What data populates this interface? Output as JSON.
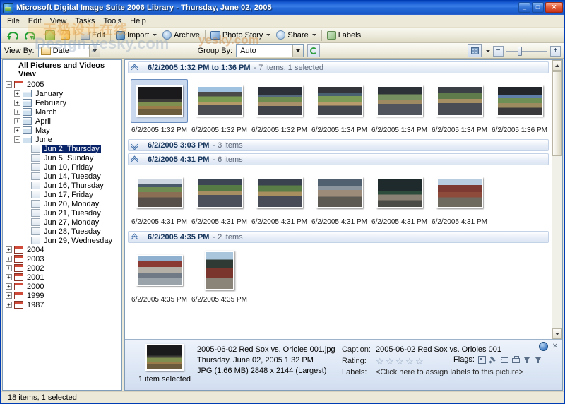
{
  "window": {
    "title": "Microsoft Digital Image Suite 2006 Library - Thursday, June 02, 2005",
    "minimize_label": "_",
    "maximize_label": "□",
    "close_label": "✕"
  },
  "menubar": {
    "items": [
      {
        "label": "File"
      },
      {
        "label": "Edit"
      },
      {
        "label": "View"
      },
      {
        "label": "Tasks"
      },
      {
        "label": "Tools"
      },
      {
        "label": "Help"
      }
    ]
  },
  "toolbar": {
    "undo_label": "",
    "redo_label": "",
    "buttons": [
      {
        "label": "Edit",
        "icon": "edit-icon",
        "has_arrow": false
      },
      {
        "label": "Import",
        "icon": "import-icon",
        "has_arrow": true
      },
      {
        "label": "Archive",
        "icon": "archive-icon",
        "has_arrow": false
      },
      {
        "label": "Photo Story",
        "icon": "photo-story-icon",
        "has_arrow": true
      },
      {
        "label": "Share",
        "icon": "share-icon",
        "has_arrow": true
      },
      {
        "label": "Labels",
        "icon": "labels-icon",
        "has_arrow": false
      }
    ]
  },
  "viewbar": {
    "view_by_label": "View By:",
    "view_by_value": "Date",
    "group_by_label": "Group By:",
    "group_by_value": "Auto",
    "refresh_icon": "refresh-icon",
    "grid_view_icon": "grid-view-icon",
    "zoom_out_label": "−",
    "zoom_in_label": "+"
  },
  "tree": {
    "root_label": "All Pictures and Videos View",
    "nodes": [
      {
        "label": "2005",
        "level": 1,
        "expander": "−",
        "type": "year"
      },
      {
        "label": "January",
        "level": 2,
        "expander": "+",
        "type": "month"
      },
      {
        "label": "February",
        "level": 2,
        "expander": "+",
        "type": "month"
      },
      {
        "label": "March",
        "level": 2,
        "expander": "+",
        "type": "month"
      },
      {
        "label": "April",
        "level": 2,
        "expander": "+",
        "type": "month"
      },
      {
        "label": "May",
        "level": 2,
        "expander": "+",
        "type": "month"
      },
      {
        "label": "June",
        "level": 2,
        "expander": "−",
        "type": "month"
      },
      {
        "label": "Jun 2, Thursday",
        "level": 3,
        "expander": "",
        "type": "day",
        "selected": true
      },
      {
        "label": "Jun 5, Sunday",
        "level": 3,
        "expander": "",
        "type": "day"
      },
      {
        "label": "Jun 10, Friday",
        "level": 3,
        "expander": "",
        "type": "day"
      },
      {
        "label": "Jun 14, Tuesday",
        "level": 3,
        "expander": "",
        "type": "day"
      },
      {
        "label": "Jun 16, Thursday",
        "level": 3,
        "expander": "",
        "type": "day"
      },
      {
        "label": "Jun 17, Friday",
        "level": 3,
        "expander": "",
        "type": "day"
      },
      {
        "label": "Jun 20, Monday",
        "level": 3,
        "expander": "",
        "type": "day"
      },
      {
        "label": "Jun 21, Tuesday",
        "level": 3,
        "expander": "",
        "type": "day"
      },
      {
        "label": "Jun 27, Monday",
        "level": 3,
        "expander": "",
        "type": "day"
      },
      {
        "label": "Jun 28, Tuesday",
        "level": 3,
        "expander": "",
        "type": "day"
      },
      {
        "label": "Jun 29, Wednesday",
        "level": 3,
        "expander": "",
        "type": "day"
      },
      {
        "label": "2004",
        "level": 1,
        "expander": "+",
        "type": "year"
      },
      {
        "label": "2003",
        "level": 1,
        "expander": "+",
        "type": "year"
      },
      {
        "label": "2002",
        "level": 1,
        "expander": "+",
        "type": "year"
      },
      {
        "label": "2001",
        "level": 1,
        "expander": "+",
        "type": "year"
      },
      {
        "label": "2000",
        "level": 1,
        "expander": "+",
        "type": "year"
      },
      {
        "label": "1999",
        "level": 1,
        "expander": "+",
        "type": "year"
      },
      {
        "label": "1987",
        "level": 1,
        "expander": "+",
        "type": "year"
      }
    ]
  },
  "groups": [
    {
      "title": "6/2/2005 1:32 PM to 1:36 PM",
      "count": "- 7 items, 1 selected",
      "state": "expanded",
      "chevron": "chevron-up-icon",
      "items": [
        {
          "caption": "6/2/2005 1:32 PM",
          "selected": true,
          "art": "ph-stadium-dark",
          "orientation": "landscape"
        },
        {
          "caption": "6/2/2005 1:32 PM",
          "selected": false,
          "art": "ph-stadium-sky",
          "orientation": "landscape"
        },
        {
          "caption": "6/2/2005 1:32 PM",
          "selected": false,
          "art": "ph-crowd-a",
          "orientation": "landscape"
        },
        {
          "caption": "6/2/2005 1:34 PM",
          "selected": false,
          "art": "ph-crowd-b",
          "orientation": "landscape"
        },
        {
          "caption": "6/2/2005 1:34 PM",
          "selected": false,
          "art": "ph-crowd-c",
          "orientation": "landscape"
        },
        {
          "caption": "6/2/2005 1:34 PM",
          "selected": false,
          "art": "ph-crowd-d",
          "orientation": "landscape"
        },
        {
          "caption": "6/2/2005 1:36 PM",
          "selected": false,
          "art": "ph-stadium-dark2",
          "orientation": "landscape"
        }
      ]
    },
    {
      "title": "6/2/2005 3:03 PM",
      "count": "- 3 items",
      "state": "collapsed",
      "chevron": "chevron-down-icon",
      "items": []
    },
    {
      "title": "6/2/2005 4:31 PM",
      "count": "- 6 items",
      "state": "expanded",
      "chevron": "chevron-up-icon",
      "items": [
        {
          "caption": "6/2/2005 4:31 PM",
          "selected": false,
          "art": "ph-fans-1",
          "orientation": "landscape"
        },
        {
          "caption": "6/2/2005 4:31 PM",
          "selected": false,
          "art": "ph-fans-2",
          "orientation": "landscape"
        },
        {
          "caption": "6/2/2005 4:31 PM",
          "selected": false,
          "art": "ph-fans-3",
          "orientation": "landscape"
        },
        {
          "caption": "6/2/2005 4:31 PM",
          "selected": false,
          "art": "ph-fans-4",
          "orientation": "landscape"
        },
        {
          "caption": "6/2/2005 4:31 PM",
          "selected": false,
          "art": "ph-greenmonster",
          "orientation": "landscape"
        },
        {
          "caption": "6/2/2005 4:31 PM",
          "selected": false,
          "art": "ph-redbrick",
          "orientation": "landscape"
        }
      ]
    },
    {
      "title": "6/2/2005 4:35 PM",
      "count": "- 2 items",
      "state": "expanded",
      "chevron": "chevron-up-icon",
      "items": [
        {
          "caption": "6/2/2005 4:35 PM",
          "selected": false,
          "art": "ph-street",
          "orientation": "landscape"
        },
        {
          "caption": "6/2/2005 4:35 PM",
          "selected": false,
          "art": "ph-tall-park",
          "orientation": "portrait"
        }
      ]
    }
  ],
  "details": {
    "selection_text": "1 item selected",
    "filename": "2005-06-02 Red Sox vs. Orioles 001.jpg",
    "datetime": "Thursday, June 02, 2005  1:32 PM",
    "fileinfo": "JPG (1.66 MB) 2848 x 2144 (Largest)",
    "caption_key": "Caption:",
    "caption_value": "2005-06-02 Red Sox vs. Orioles 001",
    "rating_key": "Rating:",
    "rating_stars": [
      "☆",
      "☆",
      "☆",
      "☆",
      "☆"
    ],
    "labels_key": "Labels:",
    "labels_value": "<Click here to assign labels to this picture>",
    "flags_key": "Flags:",
    "flag_icons": [
      "flag-square-icon",
      "flag-pencil-icon",
      "flag-mail-icon",
      "flag-print-icon",
      "flag-funnel-icon",
      "flag-funnel-2-icon"
    ],
    "help_icon": "help-icon",
    "close_icon": "close-icon"
  },
  "statusbar": {
    "text": "18 items, 1 selected"
  },
  "watermark": {
    "line1": "天极设计在线",
    "line2": "Design.yesky.com",
    "line3": "yesky.com"
  },
  "colors": {
    "titlebar_blue": "#2f6bd0",
    "selection_blue": "#0a246a",
    "group_header_text": "#17365d",
    "chrome_tan": "#ece9d8"
  }
}
